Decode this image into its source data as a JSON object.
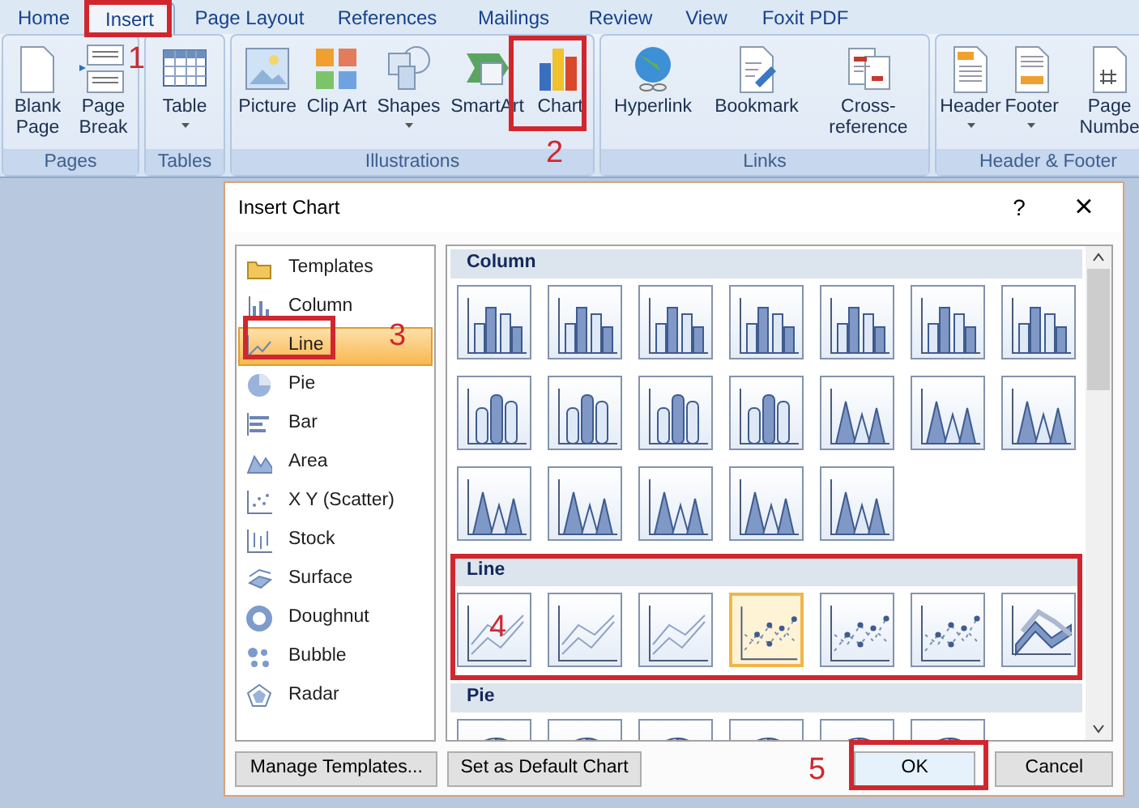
{
  "tabs": [
    {
      "label": "Home",
      "selected": false
    },
    {
      "label": "Insert",
      "selected": true
    },
    {
      "label": "Page Layout",
      "selected": false
    },
    {
      "label": "References",
      "selected": false
    },
    {
      "label": "Mailings",
      "selected": false
    },
    {
      "label": "Review",
      "selected": false
    },
    {
      "label": "View",
      "selected": false
    },
    {
      "label": "Foxit PDF",
      "selected": false
    }
  ],
  "ribbon_groups": [
    {
      "label": "Pages",
      "buttons": [
        {
          "kind": "blank-page",
          "label": "Blank Page",
          "has_menu": false
        },
        {
          "kind": "page-break",
          "label": "Page Break",
          "has_menu": false
        }
      ]
    },
    {
      "label": "Tables",
      "buttons": [
        {
          "kind": "table",
          "label": "Table",
          "has_menu": true
        }
      ]
    },
    {
      "label": "Illustrations",
      "buttons": [
        {
          "kind": "picture",
          "label": "Picture",
          "has_menu": false
        },
        {
          "kind": "clip-art",
          "label": "Clip Art",
          "has_menu": false
        },
        {
          "kind": "shapes",
          "label": "Shapes",
          "has_menu": true
        },
        {
          "kind": "smartart",
          "label": "SmartArt",
          "has_menu": false
        },
        {
          "kind": "chart",
          "label": "Chart",
          "has_menu": false
        }
      ]
    },
    {
      "label": "Links",
      "buttons": [
        {
          "kind": "hyperlink",
          "label": "Hyperlink",
          "has_menu": false
        },
        {
          "kind": "bookmark",
          "label": "Bookmark",
          "has_menu": false
        },
        {
          "kind": "cross-reference",
          "label": "Cross-reference",
          "has_menu": false
        }
      ]
    },
    {
      "label": "Header & Footer",
      "buttons": [
        {
          "kind": "header",
          "label": "Header",
          "has_menu": true
        },
        {
          "kind": "footer",
          "label": "Footer",
          "has_menu": true
        },
        {
          "kind": "page-number",
          "label": "Page Numbe",
          "has_menu": false
        }
      ]
    }
  ],
  "dialog": {
    "title": "Insert Chart",
    "help": "?",
    "close": "×",
    "chart_types": [
      {
        "kind": "templates",
        "label": "Templates",
        "selected": false
      },
      {
        "kind": "column",
        "label": "Column",
        "selected": false
      },
      {
        "kind": "line",
        "label": "Line",
        "selected": true
      },
      {
        "kind": "pie",
        "label": "Pie",
        "selected": false
      },
      {
        "kind": "bar",
        "label": "Bar",
        "selected": false
      },
      {
        "kind": "area",
        "label": "Area",
        "selected": false
      },
      {
        "kind": "scatter",
        "label": "X Y (Scatter)",
        "selected": false
      },
      {
        "kind": "stock",
        "label": "Stock",
        "selected": false
      },
      {
        "kind": "surface",
        "label": "Surface",
        "selected": false
      },
      {
        "kind": "doughnut",
        "label": "Doughnut",
        "selected": false
      },
      {
        "kind": "bubble",
        "label": "Bubble",
        "selected": false
      },
      {
        "kind": "radar",
        "label": "Radar",
        "selected": false
      }
    ],
    "gallery": [
      {
        "title": "Column",
        "thumbnails": [
          {
            "kind": "column",
            "selected": false
          },
          {
            "kind": "column",
            "selected": false
          },
          {
            "kind": "column",
            "selected": false
          },
          {
            "kind": "column",
            "selected": false
          },
          {
            "kind": "column",
            "selected": false
          },
          {
            "kind": "column",
            "selected": false
          },
          {
            "kind": "column",
            "selected": false
          },
          {
            "kind": "cylinder",
            "selected": false
          },
          {
            "kind": "cylinder",
            "selected": false
          },
          {
            "kind": "cylinder",
            "selected": false
          },
          {
            "kind": "cylinder",
            "selected": false
          },
          {
            "kind": "cone",
            "selected": false
          },
          {
            "kind": "cone",
            "selected": false
          },
          {
            "kind": "cone",
            "selected": false
          },
          {
            "kind": "cone",
            "selected": false
          },
          {
            "kind": "cone",
            "selected": false
          },
          {
            "kind": "cone",
            "selected": false
          },
          {
            "kind": "cone",
            "selected": false
          },
          {
            "kind": "cone",
            "selected": false
          }
        ]
      },
      {
        "title": "Line",
        "thumbnails": [
          {
            "kind": "line",
            "selected": false
          },
          {
            "kind": "line",
            "selected": false
          },
          {
            "kind": "line",
            "selected": false
          },
          {
            "kind": "line-markers",
            "selected": true
          },
          {
            "kind": "line-markers",
            "selected": false
          },
          {
            "kind": "line-markers",
            "selected": false
          },
          {
            "kind": "line-3d",
            "selected": false
          }
        ]
      },
      {
        "title": "Pie",
        "thumbnails": [
          {
            "kind": "pie",
            "selected": false
          },
          {
            "kind": "pie",
            "selected": false
          },
          {
            "kind": "pie",
            "selected": false
          },
          {
            "kind": "pie",
            "selected": false
          },
          {
            "kind": "pie",
            "selected": false
          },
          {
            "kind": "pie",
            "selected": false
          }
        ]
      }
    ],
    "buttons": [
      {
        "kind": "manage",
        "label": "Manage Templates..."
      },
      {
        "kind": "default",
        "label": "Set as Default Chart"
      },
      {
        "kind": "ok",
        "label": "OK"
      },
      {
        "kind": "cancel",
        "label": "Cancel"
      }
    ]
  },
  "annotations": [
    {
      "label": "1"
    },
    {
      "label": "2"
    },
    {
      "label": "3"
    },
    {
      "label": "4"
    },
    {
      "label": "5"
    }
  ]
}
